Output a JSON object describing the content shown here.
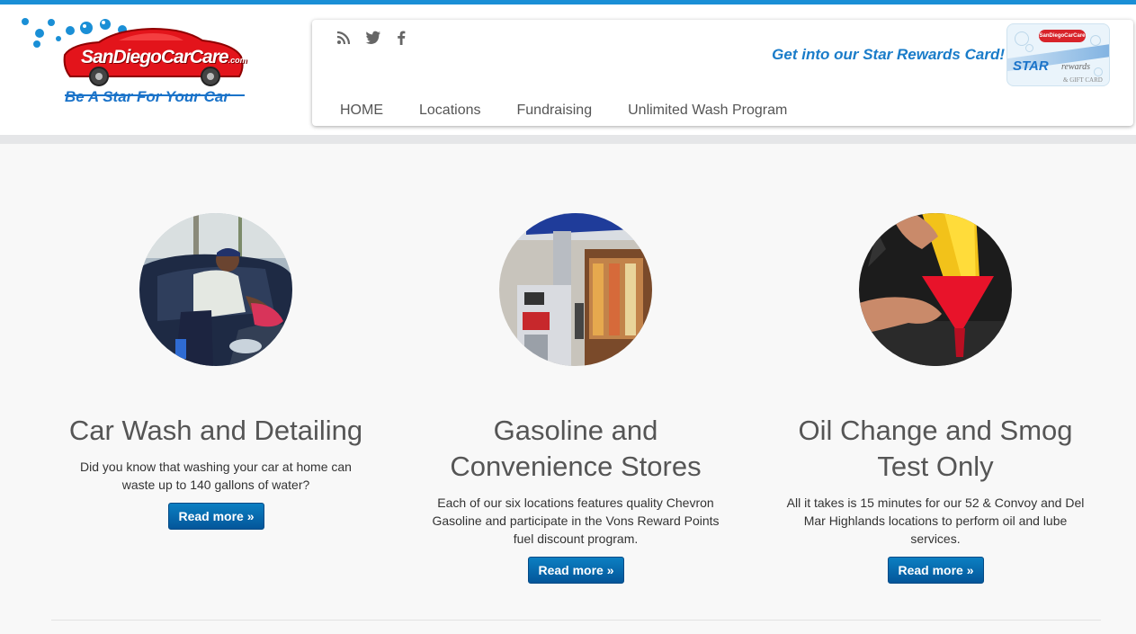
{
  "logo": {
    "name": "SanDiegoCarCare",
    "domain": ".com",
    "tagline": "Be A Star For Your Car"
  },
  "social": [
    "rss-icon",
    "twitter-icon",
    "facebook-icon"
  ],
  "promo": {
    "text": "Get into our Star Rewards Card!",
    "card_brand": "SanDiegoCarCare",
    "card_star": "STAR",
    "card_rewards": "rewards",
    "card_sub": "& GIFT CARD"
  },
  "nav": [
    {
      "label": "HOME"
    },
    {
      "label": "Locations"
    },
    {
      "label": "Fundraising"
    },
    {
      "label": "Unlimited Wash Program"
    }
  ],
  "features": [
    {
      "title_lines": [
        "Car Wash and Detailing"
      ],
      "desc": "Did you know that washing your car at home can waste up to 140 gallons of water?",
      "button": "Read more »",
      "image": "car-wash-photo"
    },
    {
      "title_lines": [
        "Gasoline and",
        "Convenience Stores"
      ],
      "desc": "Each of our six locations features quality Chevron Gasoline and participate in the Vons Reward Points fuel discount program.",
      "button": "Read more »",
      "image": "gas-station-photo"
    },
    {
      "title_lines": [
        "Oil Change and Smog",
        "Test Only"
      ],
      "desc": "All it takes is 15 minutes for our 52 & Convoy and Del Mar Highlands locations to perform oil and lube services.",
      "button": "Read more »",
      "image": "oil-change-photo"
    }
  ],
  "colors": {
    "accent": "#1a8fd6",
    "logo_red": "#e3141b",
    "button": "#0b6fb3",
    "promo": "#1a7cc9"
  }
}
